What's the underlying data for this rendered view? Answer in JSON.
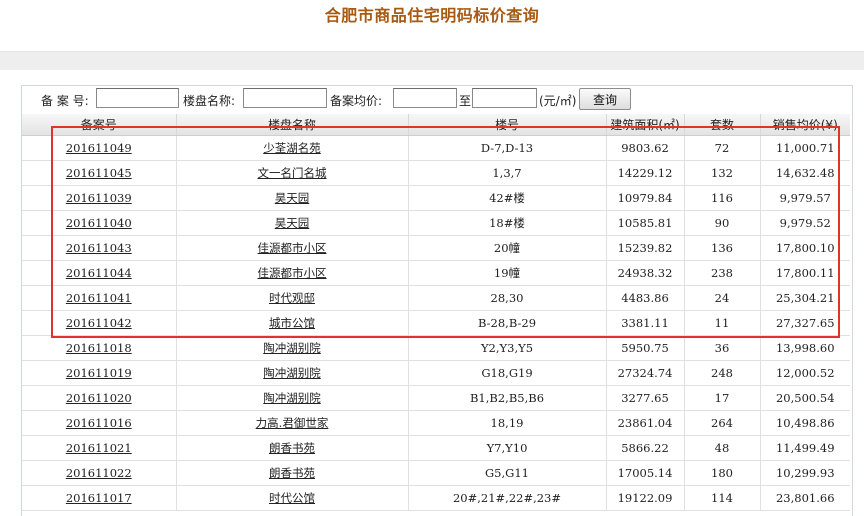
{
  "page": {
    "title": "合肥市商品住宅明码标价查询"
  },
  "search": {
    "record_no_label": "备 案 号:",
    "project_name_label": "楼盘名称:",
    "avg_price_label": "备案均价:",
    "to_label": "至",
    "unit_label": "(元/㎡)",
    "query_button": "查询",
    "record_no_value": "",
    "project_name_value": "",
    "price_min_value": "",
    "price_max_value": ""
  },
  "table": {
    "headers": [
      "备案号",
      "楼盘名称",
      "楼号",
      "建筑面积(㎡)",
      "套数",
      "销售均价(¥)"
    ],
    "rows": [
      [
        "201611049",
        "少荃湖名苑",
        "D-7,D-13",
        "9803.62",
        "72",
        "11,000.71"
      ],
      [
        "201611045",
        "文一名门名城",
        "1,3,7",
        "14229.12",
        "132",
        "14,632.48"
      ],
      [
        "201611039",
        "昊天园",
        "42#楼",
        "10979.84",
        "116",
        "9,979.57"
      ],
      [
        "201611040",
        "昊天园",
        "18#楼",
        "10585.81",
        "90",
        "9,979.52"
      ],
      [
        "201611043",
        "佳源都市小区",
        "20幢",
        "15239.82",
        "136",
        "17,800.10"
      ],
      [
        "201611044",
        "佳源都市小区",
        "19幢",
        "24938.32",
        "238",
        "17,800.11"
      ],
      [
        "201611041",
        "时代观邸",
        "28,30",
        "4483.86",
        "24",
        "25,304.21"
      ],
      [
        "201611042",
        "城市公馆",
        "B-28,B-29",
        "3381.11",
        "11",
        "27,327.65"
      ],
      [
        "201611018",
        "陶冲湖别院",
        "Y2,Y3,Y5",
        "5950.75",
        "36",
        "13,998.60"
      ],
      [
        "201611019",
        "陶冲湖别院",
        "G18,G19",
        "27324.74",
        "248",
        "12,000.52"
      ],
      [
        "201611020",
        "陶冲湖别院",
        "B1,B2,B5,B6",
        "3277.65",
        "17",
        "20,500.54"
      ],
      [
        "201611016",
        "力高.君御世家",
        "18,19",
        "23861.04",
        "264",
        "10,498.86"
      ],
      [
        "201611021",
        "朗香书苑",
        "Y7,Y10",
        "5866.22",
        "48",
        "11,499.49"
      ],
      [
        "201611022",
        "朗香书苑",
        "G5,G11",
        "17005.14",
        "180",
        "10,299.93"
      ],
      [
        "201611017",
        "时代公馆",
        "20#,21#,22#,23#",
        "19122.09",
        "114",
        "23,801.66"
      ]
    ]
  },
  "colors": {
    "title": "#a85a12",
    "highlight": "#e0332c"
  }
}
